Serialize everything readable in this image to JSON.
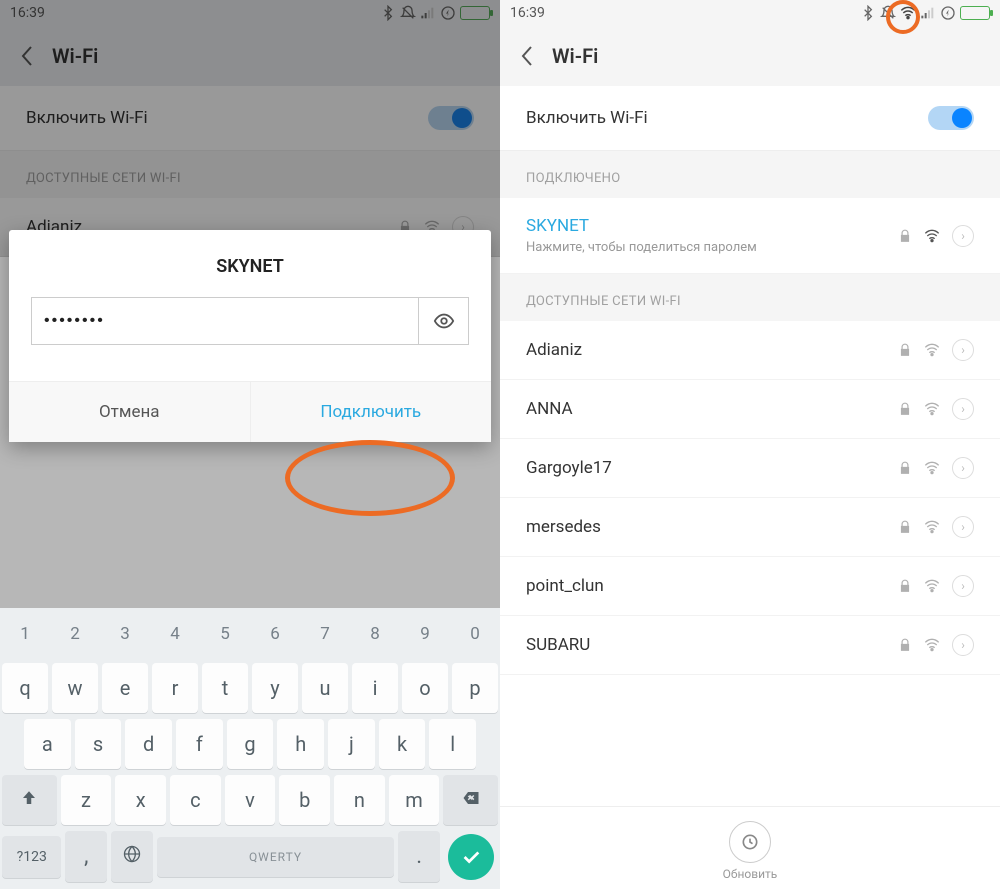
{
  "statusbar": {
    "time": "16:39"
  },
  "header": {
    "title": "Wi-Fi"
  },
  "toggle_label": "Включить Wi-Fi",
  "left": {
    "section_available": "ДОСТУПНЫЕ СЕТИ WI-FI",
    "bg_network": "Adianiz",
    "dialog": {
      "title": "SKYNET",
      "password_masked": "••••••••",
      "cancel": "Отмена",
      "connect": "Подключить"
    },
    "keyboard": {
      "num_row": [
        "1",
        "2",
        "3",
        "4",
        "5",
        "6",
        "7",
        "8",
        "9",
        "0"
      ],
      "row1": [
        "q",
        "w",
        "e",
        "r",
        "t",
        "y",
        "u",
        "i",
        "o",
        "p"
      ],
      "row2": [
        "a",
        "s",
        "d",
        "f",
        "g",
        "h",
        "j",
        "k",
        "l"
      ],
      "row3": [
        "z",
        "x",
        "c",
        "v",
        "b",
        "n",
        "m"
      ],
      "symkey": "?123",
      "space_label": "QWERTY"
    }
  },
  "right": {
    "section_connected": "ПОДКЛЮЧЕНО",
    "connected_name": "SKYNET",
    "connected_hint": "Нажмите, чтобы поделиться паролем",
    "section_available": "ДОСТУПНЫЕ СЕТИ WI-FI",
    "networks": [
      "Adianiz",
      "ANNA",
      "Gargoyle17",
      "mersedes",
      "point_clun",
      "SUBARU"
    ],
    "refresh_label": "Обновить"
  }
}
